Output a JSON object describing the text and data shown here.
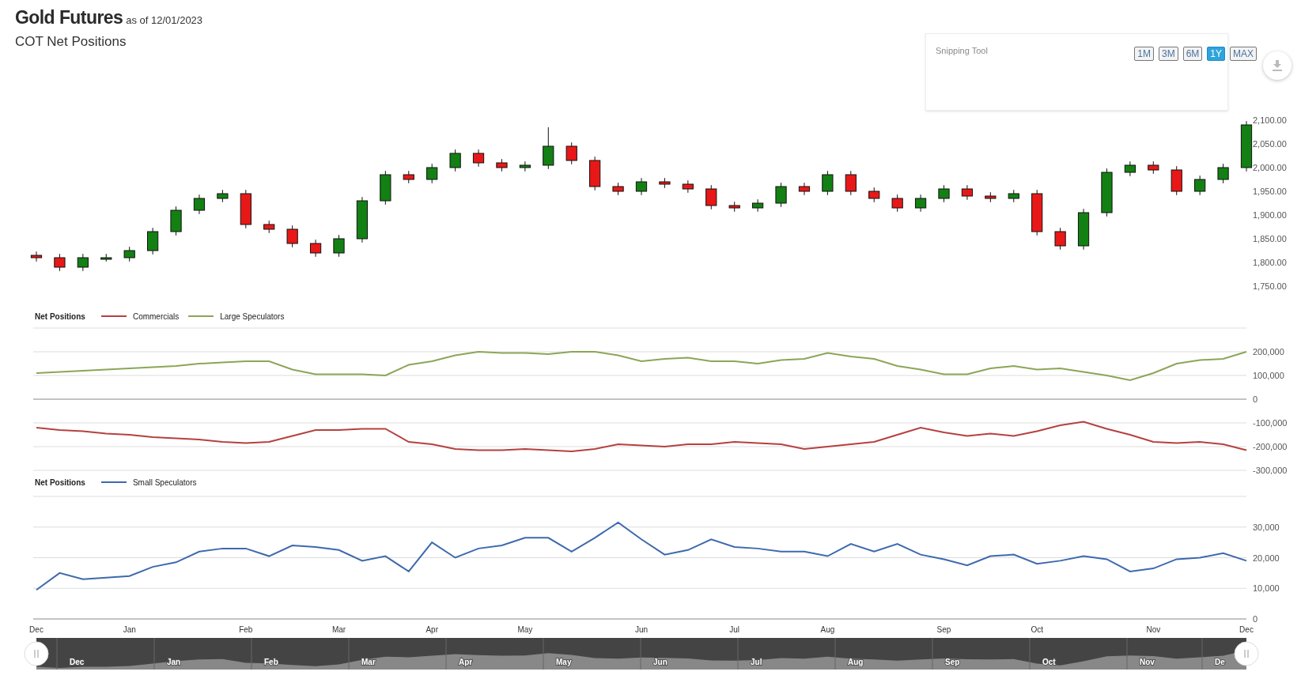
{
  "header": {
    "title": "Gold Futures",
    "as_of": "as of 12/01/2023",
    "subtitle": "COT Net Positions"
  },
  "overlay": {
    "title": "Snipping Tool"
  },
  "range_buttons": [
    {
      "label": "1M",
      "selected": false
    },
    {
      "label": "3M",
      "selected": false
    },
    {
      "label": "6M",
      "selected": false
    },
    {
      "label": "1Y",
      "selected": true
    },
    {
      "label": "MAX",
      "selected": false
    }
  ],
  "price_panel": {
    "chart_data": {
      "type": "candlestick",
      "ylim": [
        1750,
        2100
      ],
      "categories": [
        null,
        null,
        null,
        null,
        null,
        null,
        null,
        null,
        null,
        null,
        null,
        null,
        null,
        null,
        null,
        null,
        null,
        null,
        null,
        null,
        null,
        null,
        null,
        null,
        null,
        null,
        null,
        null,
        null,
        null,
        null,
        null,
        null,
        null,
        null,
        null,
        null,
        null,
        null,
        null,
        null,
        null,
        null,
        null,
        null,
        null,
        null,
        null,
        null,
        null,
        null,
        null,
        null
      ],
      "yticks": [
        {
          "value": 1750,
          "label": "1,750.00"
        },
        {
          "value": 1800,
          "label": "1,800.00"
        },
        {
          "value": 1850,
          "label": "1,850.00"
        },
        {
          "value": 1900,
          "label": "1,900.00"
        },
        {
          "value": 1950,
          "label": "1,950.00"
        },
        {
          "value": 2000,
          "label": "2,000.00"
        },
        {
          "value": 2050,
          "label": "2,050.00"
        },
        {
          "value": 2100,
          "label": "2,100.00"
        }
      ],
      "ohlc": [
        [
          1815,
          1823,
          1802,
          1810
        ],
        [
          1810,
          1818,
          1782,
          1790
        ],
        [
          1790,
          1818,
          1782,
          1810
        ],
        [
          1810,
          1818,
          1802,
          1810
        ],
        [
          1810,
          1833,
          1802,
          1825
        ],
        [
          1825,
          1873,
          1817,
          1865
        ],
        [
          1865,
          1918,
          1857,
          1910
        ],
        [
          1910,
          1943,
          1902,
          1935
        ],
        [
          1935,
          1953,
          1927,
          1945
        ],
        [
          1945,
          1953,
          1872,
          1880
        ],
        [
          1880,
          1888,
          1862,
          1870
        ],
        [
          1870,
          1878,
          1832,
          1840
        ],
        [
          1840,
          1848,
          1812,
          1820
        ],
        [
          1820,
          1858,
          1812,
          1850
        ],
        [
          1850,
          1938,
          1842,
          1930
        ],
        [
          1930,
          1993,
          1922,
          1985
        ],
        [
          1985,
          1993,
          1967,
          1975
        ],
        [
          1975,
          2008,
          1967,
          2000
        ],
        [
          2000,
          2038,
          1992,
          2030
        ],
        [
          2030,
          2038,
          2002,
          2010
        ],
        [
          2010,
          2018,
          1992,
          2000
        ],
        [
          2000,
          2013,
          1992,
          2005
        ],
        [
          2005,
          2085,
          1997,
          2045
        ],
        [
          2045,
          2053,
          2007,
          2015
        ],
        [
          2015,
          2023,
          1952,
          1960
        ],
        [
          1960,
          1968,
          1942,
          1950
        ],
        [
          1950,
          1978,
          1942,
          1970
        ],
        [
          1970,
          1978,
          1957,
          1965
        ],
        [
          1965,
          1973,
          1947,
          1955
        ],
        [
          1955,
          1963,
          1912,
          1920
        ],
        [
          1920,
          1928,
          1907,
          1915
        ],
        [
          1915,
          1933,
          1907,
          1925
        ],
        [
          1925,
          1968,
          1917,
          1960
        ],
        [
          1960,
          1968,
          1942,
          1950
        ],
        [
          1950,
          1993,
          1942,
          1985
        ],
        [
          1985,
          1993,
          1942,
          1950
        ],
        [
          1950,
          1958,
          1927,
          1935
        ],
        [
          1935,
          1943,
          1907,
          1915
        ],
        [
          1915,
          1943,
          1907,
          1935
        ],
        [
          1935,
          1963,
          1927,
          1955
        ],
        [
          1955,
          1963,
          1932,
          1940
        ],
        [
          1940,
          1948,
          1927,
          1935
        ],
        [
          1935,
          1953,
          1927,
          1945
        ],
        [
          1945,
          1953,
          1857,
          1865
        ],
        [
          1865,
          1873,
          1827,
          1835
        ],
        [
          1835,
          1913,
          1827,
          1905
        ],
        [
          1905,
          1998,
          1897,
          1990
        ],
        [
          1990,
          2013,
          1982,
          2005
        ],
        [
          2005,
          2013,
          1987,
          1995
        ],
        [
          1995,
          2003,
          1942,
          1950
        ],
        [
          1950,
          1983,
          1942,
          1975
        ],
        [
          1975,
          2008,
          1967,
          2000
        ],
        [
          2000,
          2098,
          1992,
          2090
        ]
      ]
    }
  },
  "net_positions_panel": {
    "legend_title": "Net Positions",
    "chart_data": {
      "type": "line",
      "grid": true,
      "ylim": [
        -300000,
        300000
      ],
      "categories": [
        null,
        null,
        null,
        null,
        null,
        null,
        null,
        null,
        null,
        null,
        null,
        null,
        null,
        null,
        null,
        null,
        null,
        null,
        null,
        null,
        null,
        null,
        null,
        null,
        null,
        null,
        null,
        null,
        null,
        null,
        null,
        null,
        null,
        null,
        null,
        null,
        null,
        null,
        null,
        null,
        null,
        null,
        null,
        null,
        null,
        null,
        null,
        null,
        null,
        null,
        null,
        null,
        null
      ],
      "yticks": [
        {
          "value": -300000,
          "label": "-300,000"
        },
        {
          "value": -200000,
          "label": "-200,000"
        },
        {
          "value": -100000,
          "label": "-100,000"
        },
        {
          "value": 0,
          "label": "0"
        },
        {
          "value": 100000,
          "label": "100,000"
        },
        {
          "value": 200000,
          "label": "200,000"
        }
      ],
      "series": [
        {
          "name": "Commercials",
          "color": "#b5413f",
          "values": [
            -120000,
            -130000,
            -135000,
            -145000,
            -150000,
            -160000,
            -165000,
            -170000,
            -180000,
            -185000,
            -180000,
            -155000,
            -130000,
            -130000,
            -125000,
            -125000,
            -180000,
            -190000,
            -210000,
            -215000,
            -215000,
            -210000,
            -215000,
            -220000,
            -210000,
            -190000,
            -195000,
            -200000,
            -190000,
            -190000,
            -180000,
            -185000,
            -190000,
            -210000,
            -200000,
            -190000,
            -180000,
            -150000,
            -120000,
            -140000,
            -155000,
            -145000,
            -155000,
            -135000,
            -110000,
            -95000,
            -125000,
            -150000,
            -180000,
            -185000,
            -180000,
            -190000,
            -215000
          ]
        },
        {
          "name": "Large Speculators",
          "color": "#8ba657",
          "values": [
            110000,
            115000,
            120000,
            125000,
            130000,
            135000,
            140000,
            150000,
            155000,
            160000,
            160000,
            125000,
            105000,
            105000,
            105000,
            100000,
            145000,
            160000,
            185000,
            200000,
            195000,
            195000,
            190000,
            200000,
            200000,
            185000,
            160000,
            170000,
            175000,
            160000,
            160000,
            150000,
            165000,
            170000,
            195000,
            180000,
            170000,
            140000,
            125000,
            105000,
            105000,
            130000,
            140000,
            125000,
            130000,
            115000,
            100000,
            80000,
            110000,
            150000,
            165000,
            170000,
            200000
          ]
        }
      ]
    }
  },
  "small_specs_panel": {
    "legend_title": "Net Positions",
    "chart_data": {
      "type": "line",
      "grid": true,
      "ylim": [
        0,
        40000
      ],
      "categories": [
        "Dec",
        null,
        null,
        null,
        "Jan",
        null,
        null,
        null,
        null,
        "Feb",
        null,
        null,
        null,
        "Mar",
        null,
        null,
        null,
        "Apr",
        null,
        null,
        null,
        "May",
        null,
        null,
        null,
        null,
        "Jun",
        null,
        null,
        null,
        "Jul",
        null,
        null,
        null,
        "Aug",
        null,
        null,
        null,
        null,
        "Sep",
        null,
        null,
        null,
        "Oct",
        null,
        null,
        null,
        null,
        "Nov",
        null,
        null,
        null,
        "Dec"
      ],
      "yticks": [
        {
          "value": 0,
          "label": "0"
        },
        {
          "value": 10000,
          "label": "10,000"
        },
        {
          "value": 20000,
          "label": "20,000"
        },
        {
          "value": 30000,
          "label": "30,000"
        }
      ],
      "series": [
        {
          "name": "Small Speculators",
          "color": "#3d69ad",
          "values": [
            9500,
            15000,
            13000,
            13500,
            14000,
            17000,
            18500,
            22000,
            23000,
            23000,
            20500,
            24000,
            23500,
            22500,
            19000,
            20500,
            15500,
            25000,
            20000,
            23000,
            24000,
            26500,
            26500,
            22000,
            26500,
            31500,
            26000,
            21000,
            22500,
            26000,
            23500,
            23000,
            22000,
            22000,
            20500,
            24500,
            22000,
            24500,
            21000,
            19500,
            17500,
            20500,
            21000,
            18000,
            19000,
            20500,
            19500,
            15500,
            16500,
            19500,
            20000,
            21500,
            19000
          ]
        }
      ]
    }
  },
  "navigator": {
    "labels": [
      "Dec",
      "Jan",
      "Feb",
      "Mar",
      "Apr",
      "May",
      "Jun",
      "Jul",
      "Aug",
      "Sep",
      "Oct",
      "Nov",
      "De"
    ]
  }
}
